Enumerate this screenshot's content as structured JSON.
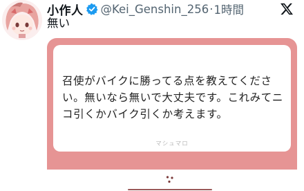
{
  "author": {
    "name": "小作人",
    "handle": "@Kei_Genshin_256",
    "separator": "·",
    "time": "1時間"
  },
  "tweet": {
    "text": "無い"
  },
  "card": {
    "message": "召使がバイクに勝ってる点を教えてください。無いなら無いで大丈夫です。これみてニコ引くかバイク引くか考えます。",
    "brand": "マシュマロ"
  },
  "colors": {
    "card_bg": "#e69494",
    "verified": "#1d9bf0",
    "muted_text": "#536471"
  },
  "icons": {
    "verified": "verified-badge-icon",
    "platform": "x-logo-icon",
    "dice": "dice-icon"
  }
}
